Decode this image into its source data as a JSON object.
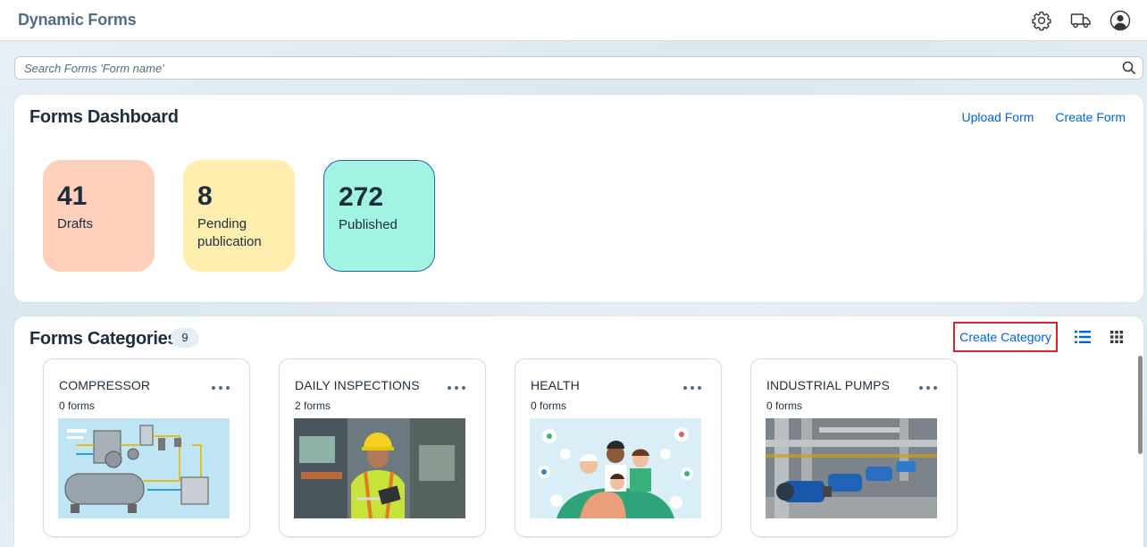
{
  "app": {
    "title": "Dynamic Forms"
  },
  "search": {
    "placeholder": "Search Forms 'Form name'"
  },
  "dashboard": {
    "title": "Forms Dashboard",
    "upload_label": "Upload Form",
    "create_label": "Create Form",
    "tiles": [
      {
        "value": "41",
        "label": "Drafts",
        "color": "#ffd0bc"
      },
      {
        "value": "8",
        "label": "Pending publication",
        "color": "#ffeeae"
      },
      {
        "value": "272",
        "label": "Published",
        "color": "#a0f4e1"
      }
    ]
  },
  "categories": {
    "title": "Forms Categories",
    "count": "9",
    "create_label": "Create Category",
    "items": [
      {
        "name": "COMPRESSOR",
        "count": "0 forms",
        "image": "compressor-diagram"
      },
      {
        "name": "DAILY INSPECTIONS",
        "count": "2 forms",
        "image": "inspector-photo"
      },
      {
        "name": "HEALTH",
        "count": "0 forms",
        "image": "health-illustration"
      },
      {
        "name": "INDUSTRIAL PUMPS",
        "count": "0 forms",
        "image": "pumps-photo"
      }
    ]
  },
  "colors": {
    "accent": "#0064d9",
    "highlight": "#d8232a",
    "text": "#1d2d3e"
  }
}
